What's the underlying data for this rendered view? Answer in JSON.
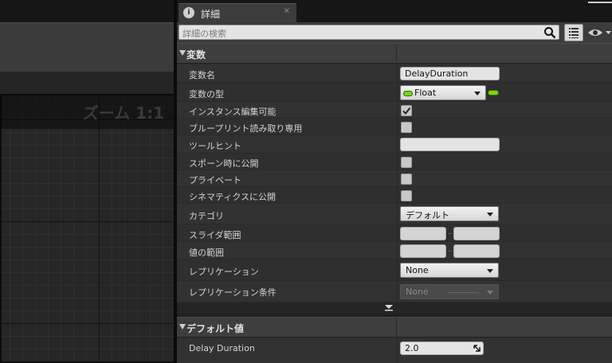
{
  "graph": {
    "zoom_label": "ズーム 1:1"
  },
  "details": {
    "tab_title": "詳細",
    "search_placeholder": "詳細の検索",
    "variable_section": {
      "title": "変数",
      "name_label": "変数名",
      "name_value": "DelayDuration",
      "type_label": "変数の型",
      "type_value": "Float",
      "instance_editable_label": "インスタンス編集可能",
      "instance_editable_checked": true,
      "blueprint_readonly_label": "ブループリント読み取り専用",
      "tooltip_label": "ツールヒント",
      "tooltip_value": "",
      "expose_on_spawn_label": "スポーン時に公開",
      "private_label": "プライベート",
      "expose_cinematics_label": "シネマティクスに公開",
      "category_label": "カテゴリ",
      "category_value": "デフォルト",
      "slider_range_label": "スライダ範囲",
      "value_range_label": "値の範囲",
      "range_separator": "..",
      "replication_label": "レプリケーション",
      "replication_value": "None",
      "replication_condition_label": "レプリケーション条件",
      "replication_condition_value": "None"
    },
    "default_section": {
      "title": "デフォルト値",
      "delay_duration_label": "Delay Duration",
      "delay_duration_value": "2.0"
    }
  },
  "colors": {
    "float_pin": "#7cd21a",
    "panel_bg": "#2c2c2c",
    "category_bg": "#3e3e3e"
  }
}
